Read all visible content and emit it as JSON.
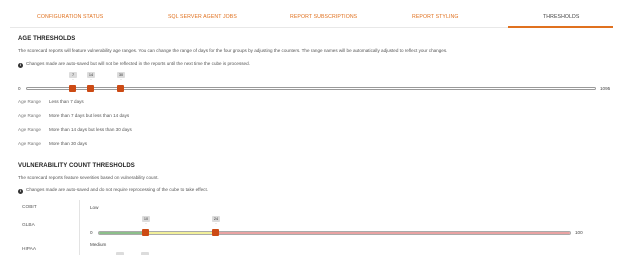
{
  "tabs": [
    {
      "label": "CONFIGURATION STATUS"
    },
    {
      "label": "SQL SERVER AGENT JOBS"
    },
    {
      "label": "REPORT SUBSCRIPTIONS"
    },
    {
      "label": "REPORT STYLING"
    },
    {
      "label": "THRESHOLDS",
      "active": true
    }
  ],
  "age": {
    "title": "AGE THRESHOLDS",
    "description": "The scorecard reports will feature vulnerability age ranges. You can change the range of days for the four groups by adjusting the counters. The range names will be automatically adjusted to reflect your changes.",
    "info": "Changes made are auto-saved but will not be reflected in the reports until the next time the cube is processed.",
    "slider": {
      "min": "0",
      "max": "1095",
      "handles": [
        "7",
        "14",
        "30"
      ]
    },
    "ranges": [
      {
        "key": "Age Range",
        "value": "Less than 7 days"
      },
      {
        "key": "Age Range",
        "value": "More than 7 days but less than 14 days"
      },
      {
        "key": "Age Range",
        "value": "More than 14 days but less than 30 days"
      },
      {
        "key": "Age Range",
        "value": "More than 30 days"
      }
    ]
  },
  "vuln": {
    "title": "VULNERABILITY COUNT THRESHOLDS",
    "description": "The scorecard reports feature severities based on vulnerability count.",
    "info": "Changes made are auto-saved and do not require reprocessing of the cube to take effect.",
    "frameworks": [
      "COBIT",
      "GLBA",
      "HIPAA"
    ],
    "low": {
      "label": "Low",
      "slider": {
        "min": "0",
        "max": "100",
        "handles": [
          "10",
          "24"
        ]
      },
      "colors": {
        "green": "#8cbf8a",
        "yellow": "#f1ef9a",
        "red": "#e9a3a3"
      }
    },
    "medium": {
      "label": "Medium"
    }
  },
  "colors": {
    "accent": "#e0711f",
    "handle": "#cc4a14"
  }
}
